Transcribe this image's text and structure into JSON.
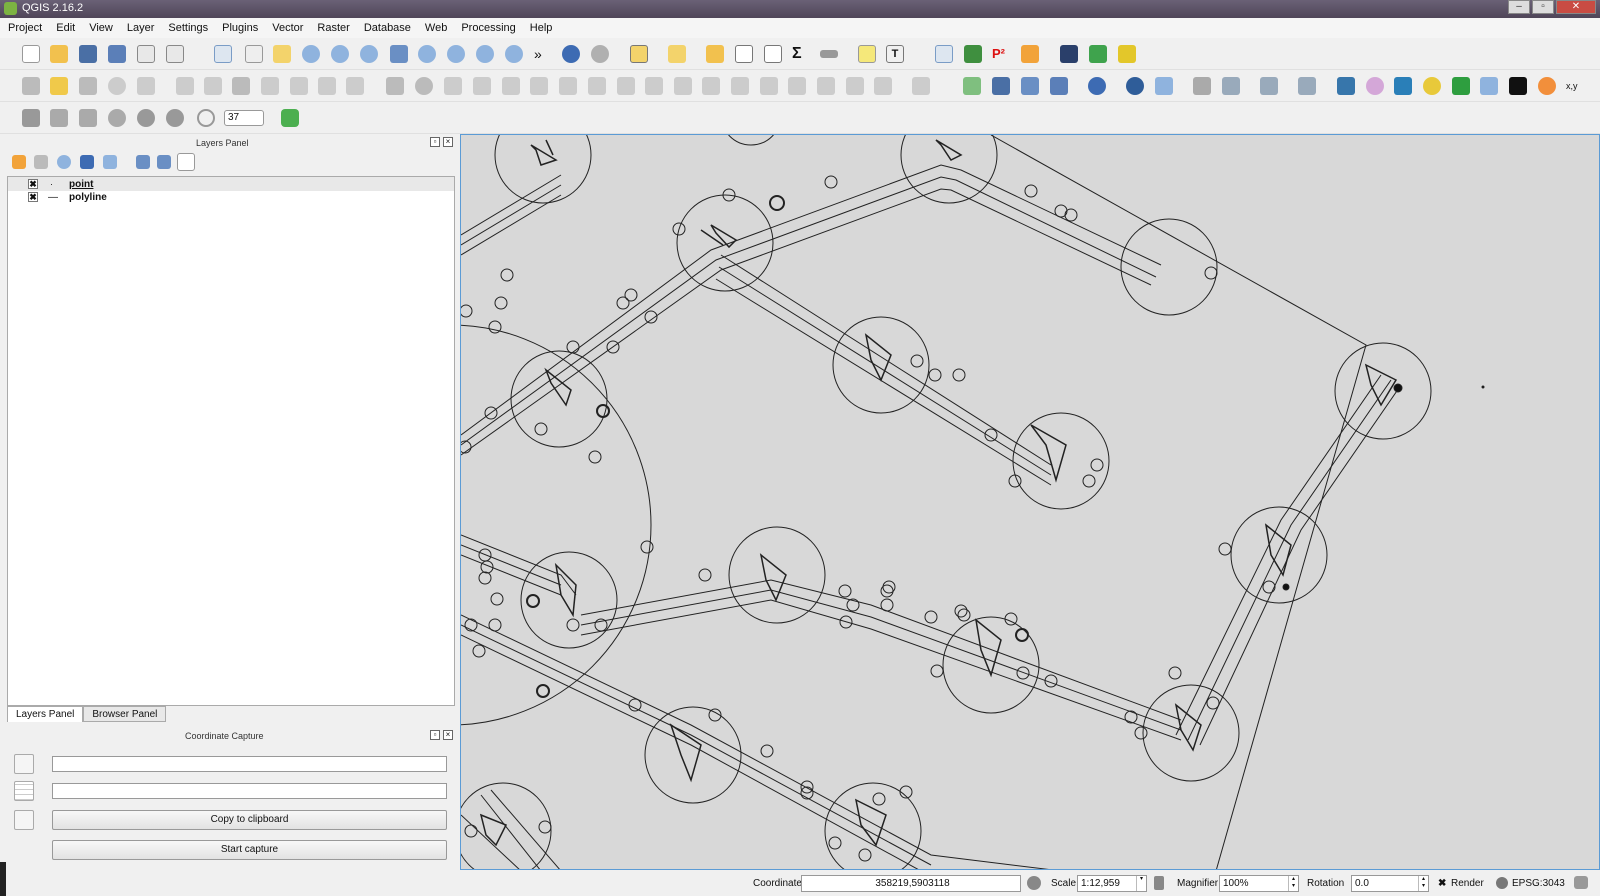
{
  "window": {
    "title": "QGIS 2.16.2",
    "buttons": [
      "–",
      "▫",
      "✕"
    ]
  },
  "menubar": {
    "items": [
      "Project",
      "Edit",
      "View",
      "Layer",
      "Settings",
      "Plugins",
      "Vector",
      "Raster",
      "Database",
      "Web",
      "Processing",
      "Help"
    ]
  },
  "toolbar3": {
    "rotation_value": "37"
  },
  "layers_panel": {
    "title": "Layers Panel",
    "layers": [
      {
        "name": "point",
        "checked": "✖",
        "symbol": "·"
      },
      {
        "name": "polyline",
        "checked": "✖",
        "symbol": "—"
      }
    ]
  },
  "tabs": [
    "Layers Panel",
    "Browser Panel"
  ],
  "coordinate_capture": {
    "title": "Coordinate Capture",
    "field1": "",
    "field2": "",
    "copy_label": "Copy to clipboard",
    "start_label": "Start capture"
  },
  "statusbar": {
    "coordinate_label": "Coordinate",
    "coordinate_value": "358219,5903118",
    "scale_label": "Scale",
    "scale_value": "1:12,959",
    "magnifier_label": "Magnifier",
    "magnifier_value": "100%",
    "rotation_label": "Rotation",
    "rotation_value": "0.0",
    "render_label": "Render",
    "render_checked": "✖",
    "crs": "EPSG:3043"
  },
  "colors": {
    "accent": "#5b9bd5",
    "map_bg": "#d8d8d8",
    "titlebar": "#5a5064"
  }
}
